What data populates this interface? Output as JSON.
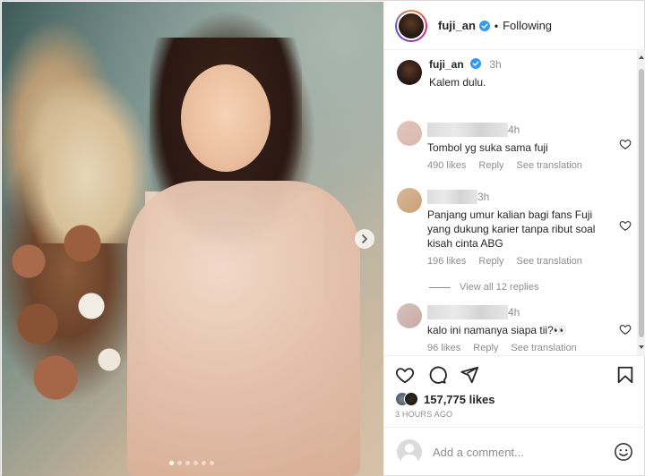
{
  "post": {
    "username": "fuji_an",
    "follow_status": "Following",
    "separator": "•",
    "caption_time": "3h",
    "caption_text": "Kalem dulu.",
    "carousel": {
      "total_slides": 6,
      "active_slide": 1
    }
  },
  "comments": [
    {
      "time": "4h",
      "text": "Tombol yg suka sama fuji",
      "likes": "490 likes",
      "reply": "Reply",
      "translate": "See translation"
    },
    {
      "time": "3h",
      "text": "Panjang umur kalian bagi fans Fuji yang dukung karier tanpa ribut soal kisah cinta ABG",
      "likes": "196 likes",
      "reply": "Reply",
      "translate": "See translation"
    },
    {
      "time": "4h",
      "text": "kalo ini namanya siapa tii?👀",
      "likes": "96 likes",
      "reply": "Reply",
      "translate": "See translation"
    }
  ],
  "view_replies": "View all 12 replies",
  "likes_count": "157,775 likes",
  "post_time": "3 HOURS AGO",
  "add_comment": {
    "placeholder": "Add a comment..."
  },
  "icons": {
    "verified": "verified-badge-icon",
    "heart": "heart-icon",
    "comment": "comment-icon",
    "share": "share-icon",
    "bookmark": "bookmark-icon",
    "emoji": "emoji-icon",
    "next": "chevron-right-icon"
  },
  "colors": {
    "verified": "#3897f0",
    "muted": "#8e8e8e",
    "text": "#262626"
  }
}
